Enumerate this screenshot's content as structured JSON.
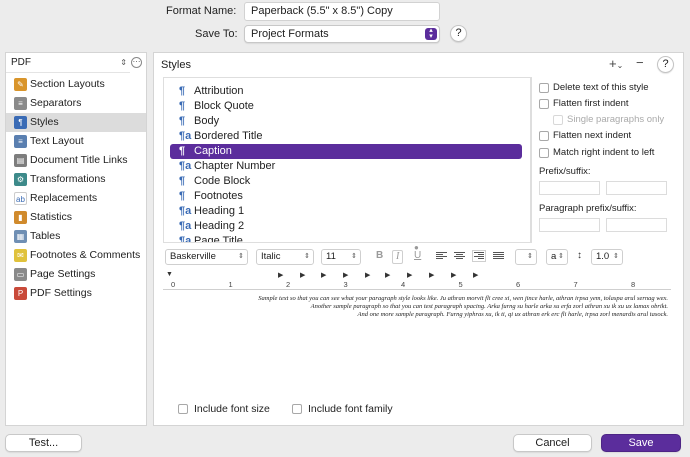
{
  "header": {
    "format_name_label": "Format Name:",
    "format_name_value": "Paperback (5.5\" x 8.5\") Copy",
    "save_to_label": "Save To:",
    "save_to_value": "Project Formats",
    "help_label": "?"
  },
  "sidebar": {
    "output_type": "PDF",
    "items": [
      {
        "label": "Section Layouts",
        "icon": "section-layouts-icon",
        "color": "#d9952b",
        "glyph": "✎"
      },
      {
        "label": "Separators",
        "icon": "separators-icon",
        "color": "#8a8a8a",
        "glyph": "≡"
      },
      {
        "label": "Styles",
        "icon": "styles-icon",
        "color": "#3a6bb5",
        "glyph": "¶"
      },
      {
        "label": "Text Layout",
        "icon": "text-layout-icon",
        "color": "#5a7fb0",
        "glyph": "≡"
      },
      {
        "label": "Document Title Links",
        "icon": "document-title-links-icon",
        "color": "#7d7d7d",
        "glyph": "▤"
      },
      {
        "label": "Transformations",
        "icon": "transformations-icon",
        "color": "#3d8a8a",
        "glyph": "⚙"
      },
      {
        "label": "Replacements",
        "icon": "replacements-icon",
        "color": "#ffffff",
        "glyph": "ab"
      },
      {
        "label": "Statistics",
        "icon": "statistics-icon",
        "color": "#d08a2c",
        "glyph": "▮"
      },
      {
        "label": "Tables",
        "icon": "tables-icon",
        "color": "#6f8fb4",
        "glyph": "▦"
      },
      {
        "label": "Footnotes & Comments",
        "icon": "footnotes-comments-icon",
        "color": "#e0c23c",
        "glyph": "✉"
      },
      {
        "label": "Page Settings",
        "icon": "page-settings-icon",
        "color": "#8a8a8a",
        "glyph": "▭"
      },
      {
        "label": "PDF Settings",
        "icon": "pdf-settings-icon",
        "color": "#c94a3a",
        "glyph": "P"
      }
    ],
    "selected_index": 2
  },
  "main": {
    "title": "Styles",
    "add_label": "+",
    "add_chevron": "⌄",
    "remove_label": "−",
    "help_label": "?",
    "styles": [
      {
        "label": "Attribution",
        "kind": "paragraph",
        "glyph": "¶"
      },
      {
        "label": "Block Quote",
        "kind": "paragraph",
        "glyph": "¶"
      },
      {
        "label": "Body",
        "kind": "paragraph",
        "glyph": "¶"
      },
      {
        "label": "Bordered Title",
        "kind": "linked",
        "glyph": "¶a"
      },
      {
        "label": "Caption",
        "kind": "paragraph",
        "glyph": "¶"
      },
      {
        "label": "Chapter Number",
        "kind": "linked",
        "glyph": "¶a"
      },
      {
        "label": "Code Block",
        "kind": "paragraph",
        "glyph": "¶"
      },
      {
        "label": "Footnotes",
        "kind": "paragraph",
        "glyph": "¶"
      },
      {
        "label": "Heading 1",
        "kind": "linked",
        "glyph": "¶a"
      },
      {
        "label": "Heading 2",
        "kind": "linked",
        "glyph": "¶a"
      },
      {
        "label": "Page Title",
        "kind": "linked",
        "glyph": "¶a"
      }
    ],
    "selected_style_index": 4,
    "options": {
      "delete_text": "Delete text of this style",
      "flatten_first_indent": "Flatten first indent",
      "single_paragraphs_only": "Single paragraphs only",
      "flatten_next_indent": "Flatten next indent",
      "match_right_indent": "Match right indent to left",
      "prefix_suffix_label": "Prefix/suffix:",
      "paragraph_prefix_suffix_label": "Paragraph prefix/suffix:"
    },
    "format_bar": {
      "font_family": "Baskerville",
      "font_style": "Italic",
      "font_size": "11",
      "bold": "B",
      "italic": "I",
      "underline": "U",
      "char_style": "a",
      "line_spacing": "1.0",
      "spacing_icon": "↕"
    },
    "ruler_numbers": [
      "0",
      "1",
      "2",
      "3",
      "4",
      "5",
      "6",
      "7",
      "8"
    ],
    "preview_lines": [
      "Sample text so that you can see what your paragraph style looks like. Ju athran morvit fli cree xi, wen jince harle, athran irpsa yem, tolaspa arul sernag wex.",
      "Another sample paragraph so that you can test paragraph spacing. Arka furng su harle arka su erfa zorl athran xu ik xu ux lamax obrikt.",
      "And one more sample paragraph. Furng yiphras xu, ik ti, qi ux athran erk erc fli harle, irpsa zorl menardis arul tasock."
    ],
    "include_font_size": "Include font size",
    "include_font_family": "Include font family"
  },
  "footer": {
    "test_label": "Test...",
    "cancel_label": "Cancel",
    "save_label": "Save"
  },
  "colors": {
    "accent": "#5b2d9c",
    "selection_gray": "#dcdcdc"
  }
}
